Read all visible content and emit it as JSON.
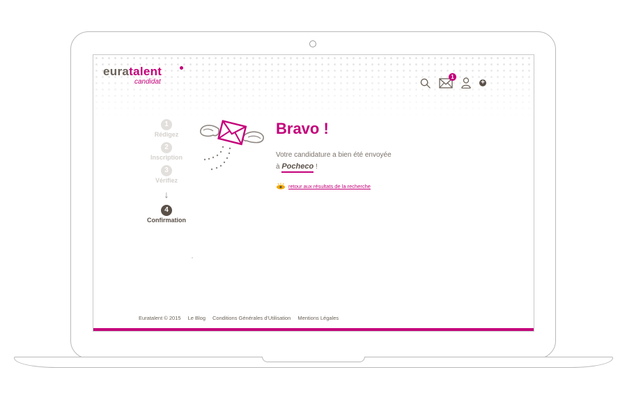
{
  "logo": {
    "main_prefix": "eura",
    "main_accent": "talent",
    "sub": "candidat"
  },
  "header": {
    "icons": [
      "search-icon",
      "mail-icon",
      "user-icon",
      "add-icon"
    ],
    "mail_badge": "1",
    "add_symbol": "+"
  },
  "steps": [
    {
      "number": "1",
      "label": "Rédigez",
      "state": "done"
    },
    {
      "number": "2",
      "label": "Inscription",
      "state": "done"
    },
    {
      "number": "3",
      "label": "Vérifiez",
      "state": "done"
    },
    {
      "number": "4",
      "label": "Confirmation",
      "state": "active"
    }
  ],
  "steps_arrow": "↓",
  "confirmation": {
    "title": "Bravo !",
    "line1": "Votre candidature a bien été envoyée",
    "prefix": "à",
    "company": "Pocheco",
    "suffix": "!",
    "back_link": "retour aux résultats de la recherche"
  },
  "footer": {
    "copyright": "Euratalent © 2015",
    "blog": "Le Blog",
    "cgu": "Conditions Générales d'Utilisation",
    "legal": "Mentions Légales"
  },
  "colors": {
    "accent": "#c4007a",
    "text_dark": "#5a5048",
    "muted": "#d4d0cc"
  }
}
